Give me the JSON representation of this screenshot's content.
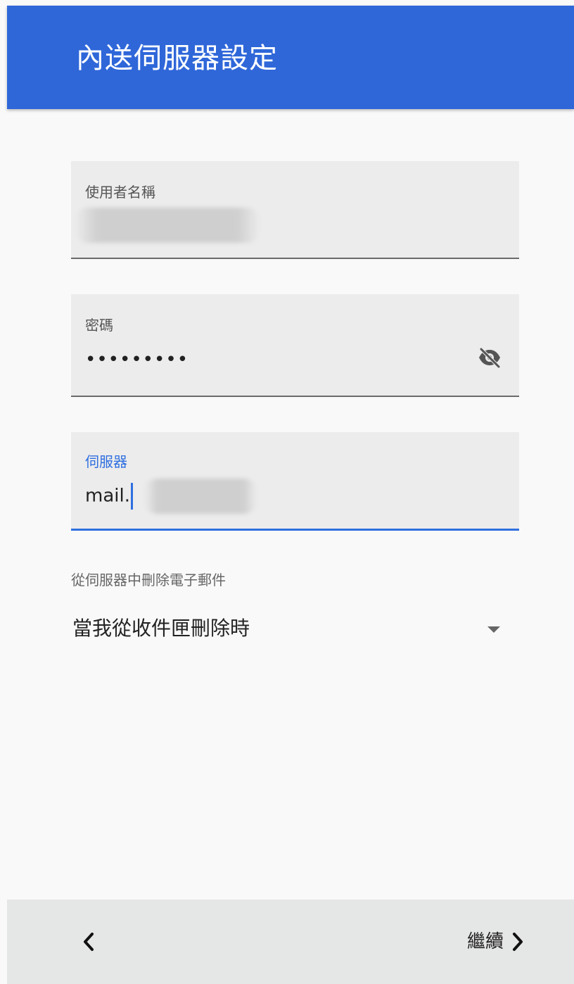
{
  "app_bar": {
    "title": "內送伺服器設定",
    "color": "#2f67d9"
  },
  "form": {
    "username": {
      "label": "使用者名稱",
      "value": ""
    },
    "password": {
      "label": "密碼",
      "value": "•••••••••",
      "toggle_icon": "visibility-off-icon"
    },
    "server": {
      "label": "伺服器",
      "value": "mail.",
      "accent": "#2f6fe0"
    },
    "delete_policy": {
      "label": "從伺服器中刪除電子郵件",
      "selected": "當我從收件匣刪除時",
      "icon": "dropdown-arrow-icon"
    }
  },
  "footer": {
    "back_icon": "chevron-left-icon",
    "next_label": "繼續",
    "next_icon": "chevron-right-icon"
  }
}
